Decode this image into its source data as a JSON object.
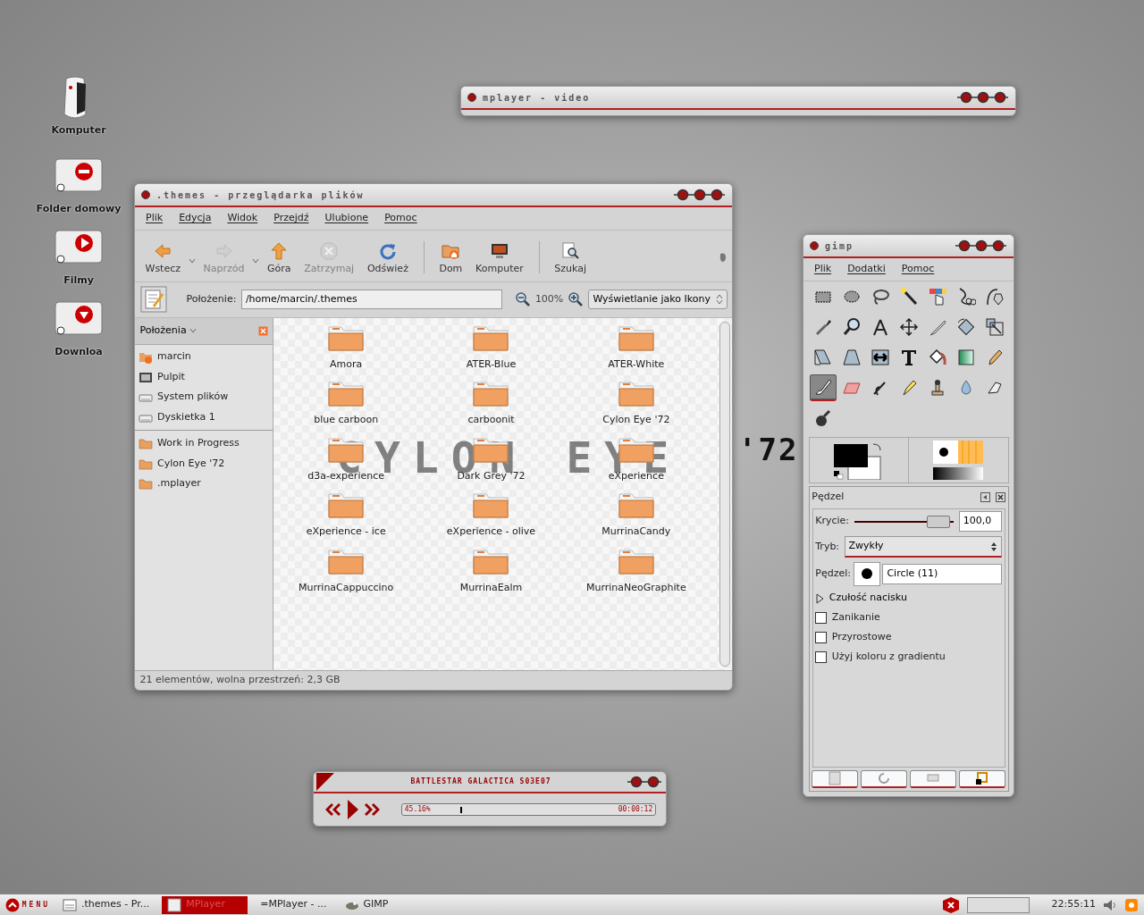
{
  "desktop_icons": [
    {
      "label": "Komputer",
      "kind": "computer"
    },
    {
      "label": "Folder domowy",
      "kind": "home"
    },
    {
      "label": "Filmy",
      "kind": "video"
    },
    {
      "label": "Downloa",
      "kind": "download"
    }
  ],
  "wallpaper": {
    "logo_left": "CYLON EYE",
    "logo_right": "'72"
  },
  "mplayer_video": {
    "title": "mplayer - video"
  },
  "file_manager": {
    "title": ".themes - przeglądarka plików",
    "menu": [
      "Plik",
      "Edycja",
      "Widok",
      "Przejdź",
      "Ulubione",
      "Pomoc"
    ],
    "toolbar": [
      {
        "kind": "back",
        "label": "Wstecz",
        "disabled": false,
        "dropdown": true
      },
      {
        "kind": "forward",
        "label": "Naprzód",
        "disabled": true,
        "dropdown": true
      },
      {
        "kind": "up",
        "label": "Góra",
        "disabled": false,
        "dropdown": false
      },
      {
        "kind": "stop",
        "label": "Zatrzymaj",
        "disabled": true,
        "dropdown": false
      },
      {
        "kind": "reload",
        "label": "Odśwież",
        "disabled": false,
        "dropdown": false
      },
      {
        "kind": "home",
        "label": "Dom",
        "disabled": false,
        "dropdown": false
      },
      {
        "kind": "computer",
        "label": "Komputer",
        "disabled": false,
        "dropdown": false
      },
      {
        "kind": "search",
        "label": "Szukaj",
        "disabled": false,
        "dropdown": false
      }
    ],
    "location_label": "Położenie:",
    "location": "/home/marcin/.themes",
    "zoom": "100%",
    "view_mode": "Wyświetlanie jako Ikony",
    "sidebar": {
      "title": "Położenia",
      "places": [
        {
          "label": "marcin",
          "kind": "home"
        },
        {
          "label": "Pulpit",
          "kind": "desktop"
        },
        {
          "label": "System plików",
          "kind": "drive"
        },
        {
          "label": "Dyskietka 1",
          "kind": "drive"
        }
      ],
      "bookmarks": [
        "Work in Progress",
        "Cylon Eye '72",
        ".mplayer"
      ]
    },
    "files": [
      "Amora",
      "ATER-Blue",
      "ATER-White",
      "blue carboon",
      "carboonit",
      "Cylon Eye '72",
      "d3a-experience",
      "Dark Grey '72",
      "eXperience",
      "eXperience - ice",
      "eXperience - olive",
      "MurrinaCandy",
      "MurrinaCappuccino",
      "MurrinaEalm",
      "MurrinaNeoGraphite"
    ],
    "status": "21 elementów, wolna przestrzeń: 2,3 GB"
  },
  "gimp": {
    "title": "gimp",
    "menu": [
      "Plik",
      "Dodatki",
      "Pomoc"
    ],
    "tools": [
      {
        "kind": "rect",
        "selected": false
      },
      {
        "kind": "ellipse",
        "selected": false
      },
      {
        "kind": "lasso",
        "selected": false
      },
      {
        "kind": "wand",
        "selected": false
      },
      {
        "kind": "colorsel",
        "selected": false
      },
      {
        "kind": "scissors",
        "selected": false
      },
      {
        "kind": "paths",
        "selected": false
      },
      {
        "kind": "picker",
        "selected": false
      },
      {
        "kind": "zoom",
        "selected": false
      },
      {
        "kind": "measure",
        "selected": false
      },
      {
        "kind": "move",
        "selected": false
      },
      {
        "kind": "crop",
        "selected": false
      },
      {
        "kind": "rotate",
        "selected": false
      },
      {
        "kind": "scale",
        "selected": false
      },
      {
        "kind": "shear",
        "selected": false
      },
      {
        "kind": "perspective",
        "selected": false
      },
      {
        "kind": "flip",
        "selected": false
      },
      {
        "kind": "text",
        "selected": false
      },
      {
        "kind": "bucket",
        "selected": false
      },
      {
        "kind": "gradient",
        "selected": false
      },
      {
        "kind": "pencil",
        "selected": false
      },
      {
        "kind": "brush",
        "selected": true
      },
      {
        "kind": "eraser",
        "selected": false
      },
      {
        "kind": "airbrush",
        "selected": false
      },
      {
        "kind": "ink",
        "selected": false
      },
      {
        "kind": "clone",
        "selected": false
      },
      {
        "kind": "blur",
        "selected": false
      },
      {
        "kind": "smudge",
        "selected": false
      },
      {
        "kind": "dodge",
        "selected": false
      }
    ],
    "panel_title": "Pędzel",
    "opacity_label": "Krycie:",
    "opacity": {
      "level": 0.95,
      "value": "100,0"
    },
    "mode_label": "Tryb:",
    "mode": "Zwykły",
    "brush_label": "Pędzel:",
    "brush": "Circle (11)",
    "pressure": {
      "label": "Czułość nacisku",
      "expanded": false
    },
    "options": [
      {
        "label": "Zanikanie",
        "checked": false
      },
      {
        "label": "Przyrostowe",
        "checked": false
      },
      {
        "label": "Użyj koloru z gradientu",
        "checked": false
      }
    ]
  },
  "player": {
    "title": "BATTLESTAR GALACTICA S03E07",
    "percent": "45.16%",
    "time": "00:00:12",
    "level": 0.23
  },
  "taskbar": {
    "menu": "MENU",
    "tasks": [
      {
        "label": ".themes - Pr...",
        "kind": "files",
        "selected": false
      },
      {
        "label": "MPlayer",
        "kind": "blank",
        "selected": true
      },
      {
        "label": "=MPlayer - ...",
        "kind": "none",
        "selected": false
      },
      {
        "label": "GIMP",
        "kind": "gimp",
        "selected": false
      }
    ],
    "clock": "22:55:11"
  }
}
